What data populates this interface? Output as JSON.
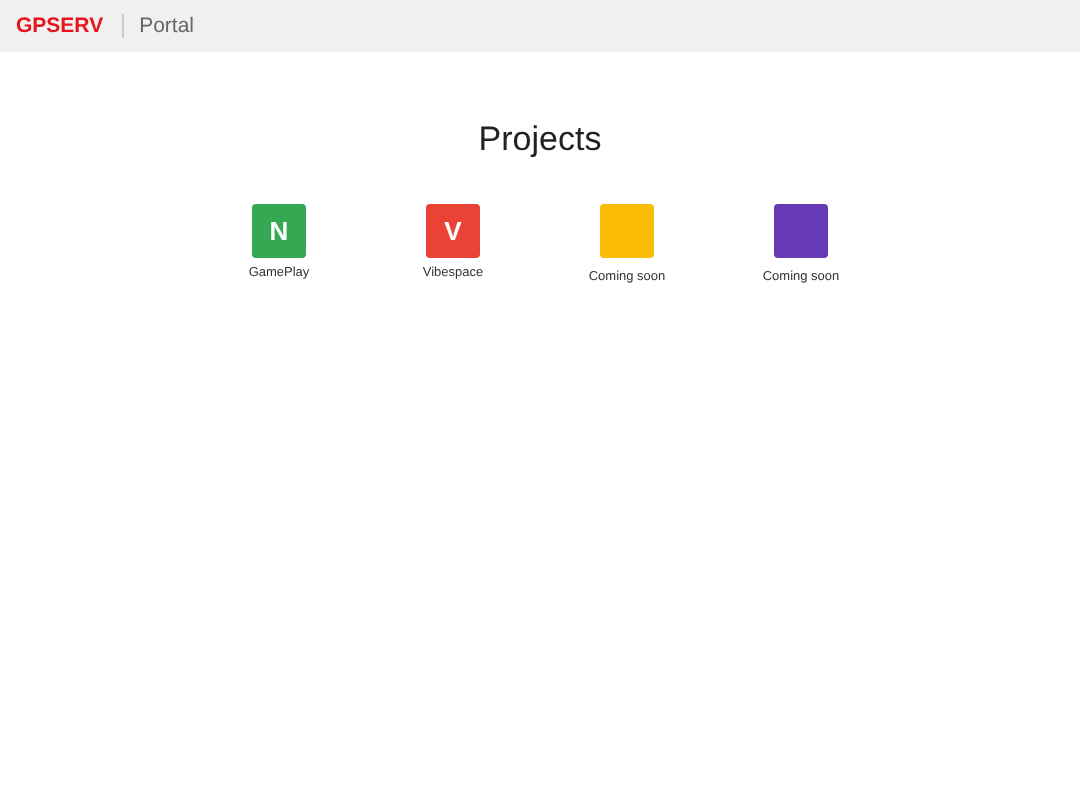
{
  "header": {
    "brand": "GPSERV",
    "title": "Portal"
  },
  "heading": "Projects",
  "projects": [
    {
      "letter": "N",
      "label": "GamePlay",
      "color": "#34a853"
    },
    {
      "letter": "V",
      "label": "Vibespace",
      "color": "#ea4335"
    },
    {
      "label": "Coming soon",
      "color": "#fbbc05"
    },
    {
      "label": "Coming soon",
      "color": "#673ab7"
    }
  ]
}
